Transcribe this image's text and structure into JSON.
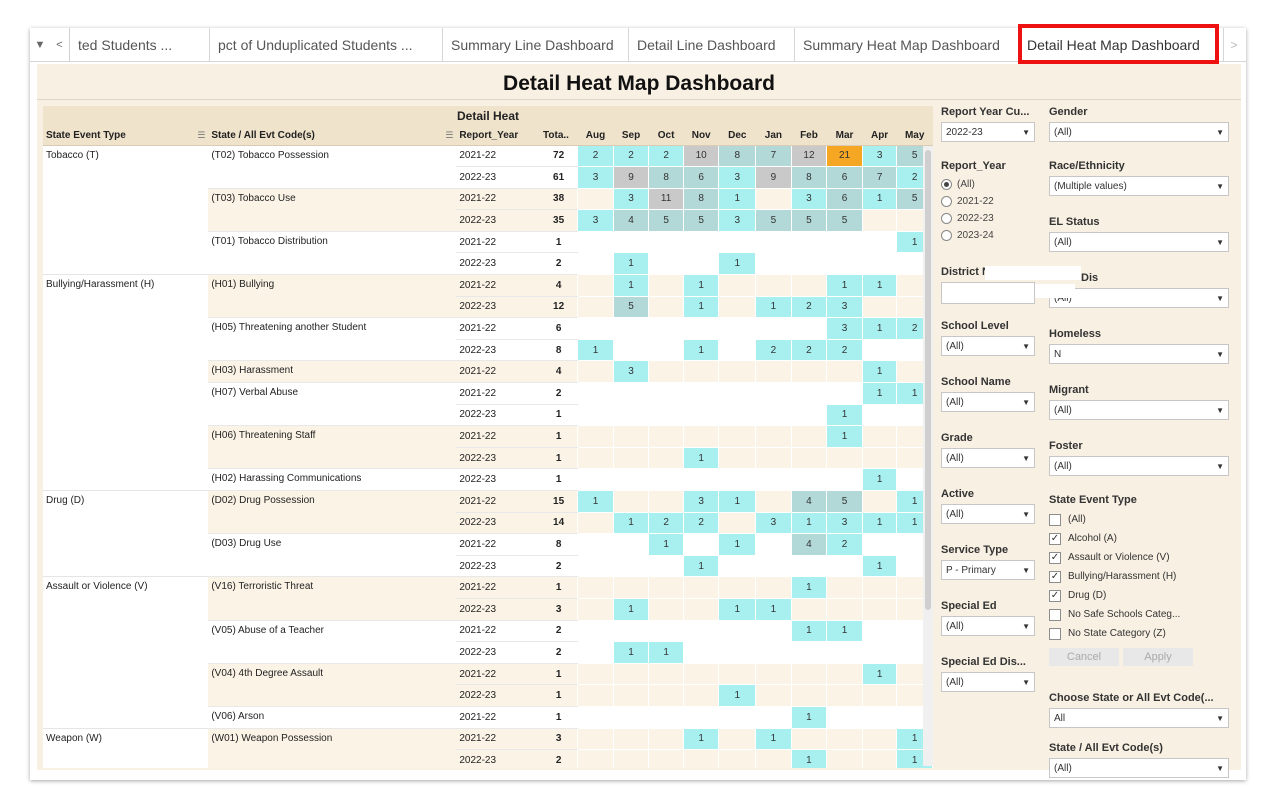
{
  "tabs": {
    "items": [
      "ted Students ...",
      "pct of Unduplicated Students ...",
      "Summary Line Dashboard",
      "Detail Line Dashboard",
      "Summary Heat Map Dashboard",
      "Detail Heat Map Dashboard"
    ],
    "active": "Detail Heat Map Dashboard"
  },
  "dashboard": {
    "title": "Detail Heat Map Dashboard",
    "heat_title": "Detail Heat"
  },
  "columns": {
    "event_type": "State Event Type",
    "code": "State / All Evt Code(s)",
    "year": "Report_Year",
    "total": "Tota..",
    "months": [
      "Aug",
      "Sep",
      "Oct",
      "Nov",
      "Dec",
      "Jan",
      "Feb",
      "Mar",
      "Apr",
      "May"
    ]
  },
  "rows": [
    {
      "group": "Tobacco (T)",
      "code": "(T02) Tobacco Possession",
      "year": "2021-22",
      "total": "72",
      "months": [
        "2",
        "2",
        "2",
        "10",
        "8",
        "7",
        "12",
        "21",
        "3",
        "5"
      ]
    },
    {
      "group": "",
      "code": "",
      "year": "2022-23",
      "total": "61",
      "months": [
        "3",
        "9",
        "8",
        "6",
        "3",
        "9",
        "8",
        "6",
        "7",
        "2"
      ]
    },
    {
      "group": "",
      "code": "(T03) Tobacco Use",
      "year": "2021-22",
      "total": "38",
      "months": [
        "",
        "3",
        "11",
        "8",
        "1",
        "",
        "3",
        "6",
        "1",
        "5"
      ]
    },
    {
      "group": "",
      "code": "",
      "year": "2022-23",
      "total": "35",
      "months": [
        "3",
        "4",
        "5",
        "5",
        "3",
        "5",
        "5",
        "5",
        "",
        ""
      ]
    },
    {
      "group": "",
      "code": "(T01) Tobacco Distribution",
      "year": "2021-22",
      "total": "1",
      "months": [
        "",
        "",
        "",
        "",
        "",
        "",
        "",
        "",
        "",
        "1"
      ]
    },
    {
      "group": "",
      "code": "",
      "year": "2022-23",
      "total": "2",
      "months": [
        "",
        "1",
        "",
        "",
        "1",
        "",
        "",
        "",
        "",
        ""
      ]
    },
    {
      "group": "Bullying/Harassment (H)",
      "code": "(H01) Bullying",
      "year": "2021-22",
      "total": "4",
      "months": [
        "",
        "1",
        "",
        "1",
        "",
        "",
        "",
        "1",
        "1",
        ""
      ]
    },
    {
      "group": "",
      "code": "",
      "year": "2022-23",
      "total": "12",
      "months": [
        "",
        "5",
        "",
        "1",
        "",
        "1",
        "2",
        "3",
        "",
        ""
      ]
    },
    {
      "group": "",
      "code": "(H05) Threatening another Student",
      "year": "2021-22",
      "total": "6",
      "months": [
        "",
        "",
        "",
        "",
        "",
        "",
        "",
        "3",
        "1",
        "2"
      ]
    },
    {
      "group": "",
      "code": "",
      "year": "2022-23",
      "total": "8",
      "months": [
        "1",
        "",
        "",
        "1",
        "",
        "2",
        "2",
        "2",
        "",
        ""
      ]
    },
    {
      "group": "",
      "code": "(H03) Harassment",
      "year": "2021-22",
      "total": "4",
      "months": [
        "",
        "3",
        "",
        "",
        "",
        "",
        "",
        "",
        "1",
        ""
      ]
    },
    {
      "group": "",
      "code": "(H07) Verbal Abuse",
      "year": "2021-22",
      "total": "2",
      "months": [
        "",
        "",
        "",
        "",
        "",
        "",
        "",
        "",
        "1",
        "1"
      ]
    },
    {
      "group": "",
      "code": "",
      "year": "2022-23",
      "total": "1",
      "months": [
        "",
        "",
        "",
        "",
        "",
        "",
        "",
        "1",
        "",
        ""
      ]
    },
    {
      "group": "",
      "code": "(H06) Threatening Staff",
      "year": "2021-22",
      "total": "1",
      "months": [
        "",
        "",
        "",
        "",
        "",
        "",
        "",
        "1",
        "",
        ""
      ]
    },
    {
      "group": "",
      "code": "",
      "year": "2022-23",
      "total": "1",
      "months": [
        "",
        "",
        "",
        "1",
        "",
        "",
        "",
        "",
        "",
        ""
      ]
    },
    {
      "group": "",
      "code": "(H02) Harassing Communications",
      "year": "2022-23",
      "total": "1",
      "months": [
        "",
        "",
        "",
        "",
        "",
        "",
        "",
        "",
        "1",
        ""
      ]
    },
    {
      "group": "Drug (D)",
      "code": "(D02) Drug Possession",
      "year": "2021-22",
      "total": "15",
      "months": [
        "1",
        "",
        "",
        "3",
        "1",
        "",
        "4",
        "5",
        "",
        "1"
      ]
    },
    {
      "group": "",
      "code": "",
      "year": "2022-23",
      "total": "14",
      "months": [
        "",
        "1",
        "2",
        "2",
        "",
        "3",
        "1",
        "3",
        "1",
        "1"
      ]
    },
    {
      "group": "",
      "code": "(D03) Drug Use",
      "year": "2021-22",
      "total": "8",
      "months": [
        "",
        "",
        "1",
        "",
        "1",
        "",
        "4",
        "2",
        "",
        ""
      ]
    },
    {
      "group": "",
      "code": "",
      "year": "2022-23",
      "total": "2",
      "months": [
        "",
        "",
        "",
        "1",
        "",
        "",
        "",
        "",
        "1",
        ""
      ]
    },
    {
      "group": "Assault or Violence (V)",
      "code": "(V16) Terroristic Threat",
      "year": "2021-22",
      "total": "1",
      "months": [
        "",
        "",
        "",
        "",
        "",
        "",
        "1",
        "",
        "",
        ""
      ]
    },
    {
      "group": "",
      "code": "",
      "year": "2022-23",
      "total": "3",
      "months": [
        "",
        "1",
        "",
        "",
        "1",
        "1",
        "",
        "",
        "",
        ""
      ]
    },
    {
      "group": "",
      "code": "(V05) Abuse of a Teacher",
      "year": "2021-22",
      "total": "2",
      "months": [
        "",
        "",
        "",
        "",
        "",
        "",
        "1",
        "1",
        "",
        ""
      ]
    },
    {
      "group": "",
      "code": "",
      "year": "2022-23",
      "total": "2",
      "months": [
        "",
        "1",
        "1",
        "",
        "",
        "",
        "",
        "",
        "",
        ""
      ]
    },
    {
      "group": "",
      "code": "(V04) 4th Degree Assault",
      "year": "2021-22",
      "total": "1",
      "months": [
        "",
        "",
        "",
        "",
        "",
        "",
        "",
        "",
        "1",
        ""
      ]
    },
    {
      "group": "",
      "code": "",
      "year": "2022-23",
      "total": "1",
      "months": [
        "",
        "",
        "",
        "",
        "1",
        "",
        "",
        "",
        "",
        ""
      ]
    },
    {
      "group": "",
      "code": "(V06) Arson",
      "year": "2021-22",
      "total": "1",
      "months": [
        "",
        "",
        "",
        "",
        "",
        "",
        "1",
        "",
        "",
        ""
      ]
    },
    {
      "group": "Weapon (W)",
      "code": "(W01) Weapon  Possession",
      "year": "2021-22",
      "total": "3",
      "months": [
        "",
        "",
        "",
        "1",
        "",
        "1",
        "",
        "",
        "",
        "1"
      ]
    },
    {
      "group": "",
      "code": "",
      "year": "2022-23",
      "total": "2",
      "months": [
        "",
        "",
        "",
        "",
        "",
        "",
        "1",
        "",
        "",
        "1"
      ]
    }
  ],
  "heat_colors": {
    "low": "#a8f0f0",
    "mid": "#b2d8d8",
    "high": "#c9c9c9",
    "peak": "#f5a623"
  },
  "filters": {
    "report_year_cu": {
      "label": "Report Year Cu...",
      "value": "2022-23"
    },
    "report_year": {
      "label": "Report_Year",
      "options": [
        "(All)",
        "2021-22",
        "2022-23",
        "2023-24"
      ],
      "selected": "(All)"
    },
    "district_name": {
      "label": "District Name",
      "value": ""
    },
    "school_level": {
      "label": "School Level",
      "value": "(All)"
    },
    "school_name": {
      "label": "School Name",
      "value": "(All)"
    },
    "grade": {
      "label": "Grade",
      "value": "(All)"
    },
    "active": {
      "label": "Active",
      "value": "(All)"
    },
    "service_type": {
      "label": "Service Type",
      "value": "P - Primary"
    },
    "special_ed": {
      "label": "Special Ed",
      "value": "(All)"
    },
    "special_ed_dis": {
      "label": "Special Ed Dis...",
      "value": "(All)"
    },
    "gender": {
      "label": "Gender",
      "value": "(All)"
    },
    "race": {
      "label": "Race/Ethnicity",
      "value": "(Multiple values)"
    },
    "el_status": {
      "label": "EL Status",
      "value": "(All)"
    },
    "econ_dis": {
      "label": "Dis",
      "value": "(All)"
    },
    "homeless": {
      "label": "Homeless",
      "value": "N"
    },
    "migrant": {
      "label": "Migrant",
      "value": "(All)"
    },
    "foster": {
      "label": "Foster",
      "value": "(All)"
    },
    "state_event_type": {
      "label": "State Event Type",
      "items": [
        {
          "label": "(All)",
          "checked": false
        },
        {
          "label": "Alcohol (A)",
          "checked": true
        },
        {
          "label": "Assault or Violence (V)",
          "checked": true
        },
        {
          "label": "Bullying/Harassment (H)",
          "checked": true
        },
        {
          "label": "Drug (D)",
          "checked": true
        },
        {
          "label": "No Safe Schools Categ...",
          "checked": false
        },
        {
          "label": "No State Category (Z)",
          "checked": false
        }
      ],
      "cancel": "Cancel",
      "apply": "Apply"
    },
    "choose_code": {
      "label": "Choose State or All Evt Code(...",
      "value": "All"
    },
    "state_all_code": {
      "label": "State / All Evt Code(s)",
      "value": "(All)"
    }
  }
}
